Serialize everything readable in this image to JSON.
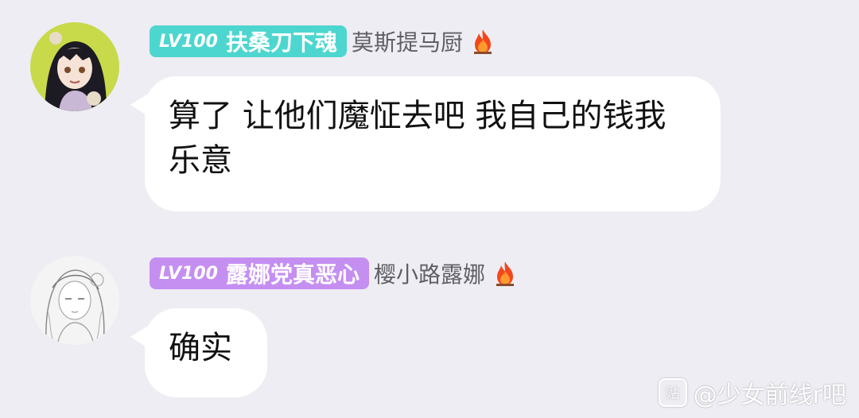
{
  "colors": {
    "background": "#eeedf3",
    "tag1": "#4dd6cf",
    "tag2": "#c58ff2",
    "bubble": "#ffffff",
    "username": "#5f5f66"
  },
  "messages": [
    {
      "avatar_icon": "anime-girl-avatar-icon",
      "level": "LV100",
      "title": "扶桑刀下魂",
      "username": "莫斯提马厨",
      "badge_icon": "fire-icon",
      "text": "算了 让他们魔怔去吧 我自己的钱我乐意"
    },
    {
      "avatar_icon": "sketch-girl-avatar-icon",
      "level": "LV100",
      "title": "露娜党真恶心",
      "username": "樱小路露娜",
      "badge_icon": "fire-icon",
      "text": "确实"
    }
  ],
  "watermark": {
    "icon": "tieba-logo-icon",
    "logo_text": "贴",
    "text": "@少女前线r吧"
  }
}
